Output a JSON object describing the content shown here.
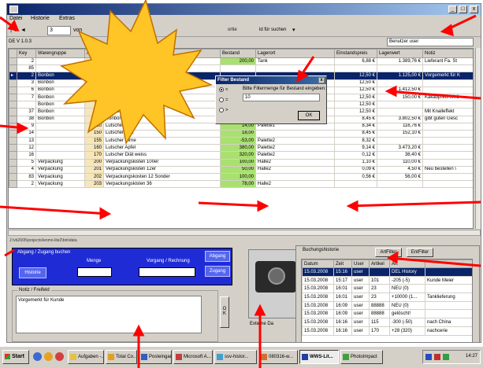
{
  "window": {
    "title": "",
    "menu": [
      "Datei",
      "Historie",
      "Extras"
    ],
    "version": "DE V 1.0.3",
    "controls": {
      "minimize": "_",
      "maximize": "□",
      "close": "x"
    }
  },
  "navigation": {
    "first": "|◄",
    "prev": "◄",
    "current": "3",
    "of_label": "von",
    "next": "►",
    "last": "►|",
    "sort_text": "ortie",
    "search_text": "ld für suchen",
    "dropdown": "▾"
  },
  "user_field": "Benutzer user",
  "grid": {
    "columns": [
      "",
      "Key",
      "Warengruppe",
      "ArtNr",
      "",
      "Bestand",
      "Lagerort",
      "Einstandspreis",
      "Lagerwert",
      "Notiz"
    ],
    "rows": [
      {
        "key": "2",
        "group": "",
        "artnr": "2",
        "name": "Sirup 5kg Sack",
        "stock": "200,00",
        "location": "Tank",
        "cost": "6,88 €",
        "value": "1.389,76 €",
        "note": "Lieferant Fa. St",
        "indicator": "",
        "green": true,
        "active": false
      },
      {
        "key": "85",
        "group": "",
        "artnr": "23",
        "name": "Sirup Fliesware",
        "stock": "",
        "location": "",
        "cost": "",
        "value": "",
        "note": "",
        "indicator": "",
        "green": false,
        "active": false
      },
      {
        "key": "2",
        "group": "Bonbon",
        "artnr": "100",
        "name": "Bonbon rot",
        "stock": "",
        "location": "",
        "cost": "12,50 €",
        "value": "1.125,00 €",
        "note": "Vorgemerkt für K",
        "indicator": "▸",
        "green": false,
        "active": true
      },
      {
        "key": "3",
        "group": "Bonbon",
        "artnr": "101",
        "name": "Bonbon blau weiss",
        "stock": "",
        "location": "",
        "cost": "12,50 €",
        "value": "",
        "note": "",
        "indicator": "",
        "green": false,
        "active": false
      },
      {
        "key": "6",
        "group": "Bonbon",
        "artnr": "102",
        "name": "Bonbon Kamille",
        "stock": "",
        "location": "",
        "cost": "12,50 €",
        "value": "1.412,50 €",
        "note": "",
        "indicator": "",
        "green": false,
        "active": false
      },
      {
        "key": "7",
        "group": "Bonbon",
        "artnr": "103",
        "name": "Bonbon Kakao",
        "stock": "",
        "location": "",
        "cost": "12,50 €",
        "value": "150,00 €",
        "note": "Kakaopreis erhö",
        "indicator": "",
        "green": false,
        "active": false
      },
      {
        "key": "",
        "group": "Bonbon",
        "artnr": "110",
        "name": "Bonbon Nikolaus",
        "stock": "-10,00",
        "location": "",
        "cost": "12,50 €",
        "value": "",
        "note": "",
        "indicator": "",
        "green": false,
        "active": false
      },
      {
        "key": "37",
        "group": "Bonbon",
        "artnr": "115",
        "name": "Bonbon Silvester",
        "stock": "-50,00",
        "location": "",
        "cost": "12,50 €",
        "value": "",
        "note": "Mit Knalleffekt",
        "indicator": "",
        "green": false,
        "active": false
      },
      {
        "key": "38",
        "group": "Bonbon",
        "artnr": "116",
        "name": "Bonbon Neujahr",
        "stock": "450,00",
        "location": "in Produktion",
        "cost": "8,45 €",
        "value": "3.802,50 €",
        "note": "gibt guten Gesc",
        "indicator": "",
        "green": true,
        "active": false
      },
      {
        "key": "9",
        "group": "",
        "artnr": "120",
        "name": "Lutscher Rot",
        "stock": "14,00",
        "location": "Palette1",
        "cost": "8,34 €",
        "value": "116,76 €",
        "note": "",
        "indicator": "",
        "green": true,
        "active": false
      },
      {
        "key": "14",
        "group": "",
        "artnr": "150",
        "name": "Lutscher Diät",
        "stock": "18,00",
        "location": "",
        "cost": "8,45 €",
        "value": "152,10 €",
        "note": "",
        "indicator": "",
        "green": true,
        "active": false
      },
      {
        "key": "13",
        "group": "",
        "artnr": "155",
        "name": "Lutscher Birne",
        "stock": "-53,00",
        "location": "Palette2",
        "cost": "8,32 €",
        "value": "",
        "note": "",
        "indicator": "",
        "green": true,
        "active": false
      },
      {
        "key": "12",
        "group": "",
        "artnr": "160",
        "name": "Lutscher Apfel",
        "stock": "380,00",
        "location": "Palette2",
        "cost": "9,14 €",
        "value": "3.473,20 €",
        "note": "",
        "indicator": "",
        "green": true,
        "active": false
      },
      {
        "key": "16",
        "group": "",
        "artnr": "170",
        "name": "Lutscher Diät weiss",
        "stock": "320,00",
        "location": "Palette2",
        "cost": "0,12 €",
        "value": "38,40 €",
        "note": "",
        "indicator": "",
        "green": true,
        "active": false
      },
      {
        "key": "5",
        "group": "Verpackung",
        "artnr": "200",
        "name": "Verpackungskisten 100er",
        "stock": "100,00",
        "location": "Halle2",
        "cost": "1,10 €",
        "value": "110,00 €",
        "note": "",
        "indicator": "",
        "green": true,
        "active": false
      },
      {
        "key": "4",
        "group": "Verpackung",
        "artnr": "201",
        "name": "Verpackungskisten 12er",
        "stock": "50,00",
        "location": "Halle2",
        "cost": "0,09 €",
        "value": "4,50 €",
        "note": "Neu bestellen \\",
        "indicator": "",
        "green": true,
        "active": false
      },
      {
        "key": "83",
        "group": "Verpackung",
        "artnr": "202",
        "name": "Verpackungskosten 12 Sonder",
        "stock": "100,00",
        "location": "",
        "cost": "0,56 €",
        "value": "56,00 €",
        "note": "",
        "indicator": "",
        "green": true,
        "active": false
      },
      {
        "key": "2",
        "group": "Verpackung",
        "artnr": "203",
        "name": "Verpackungskisten 36",
        "stock": "78,00",
        "location": "Halle2",
        "cost": "",
        "value": "",
        "note": "",
        "indicator": "",
        "green": true,
        "active": false
      }
    ]
  },
  "path_text": "J:\\vb2005\\projects\\lenmo-lite2\\bin\\data",
  "booking": {
    "title": "Abgang / Zugang buchen",
    "menge_label": "Menge",
    "vorgang_label": "Vorgang / Rechnung",
    "history_button": "Historie",
    "abgang_button": "Abgang",
    "zugang_button": "Zugang"
  },
  "notes": {
    "title": "Notiz / Freifeld",
    "text": "Vorgemerkt für Kunde",
    "ok_button": "O K"
  },
  "image_caption": "Externe Da",
  "history": {
    "title": "Buchungshistorie",
    "art_filter": "ArtFilter",
    "ent_filter": "EntFilter",
    "columns": [
      "Datum",
      "Zeit",
      "User",
      "Artikel",
      "Art"
    ],
    "rows": [
      {
        "date": "15.03.2008",
        "time": "15:16",
        "user": "user",
        "article": "",
        "art": "DEL History",
        "info": "",
        "active": true
      },
      {
        "date": "15.03.2008",
        "time": "15:17",
        "user": "user",
        "article": "101",
        "art": "-205 (-5)",
        "info": "Kunde Meier",
        "active": false
      },
      {
        "date": "15.03.2008",
        "time": "16:01",
        "user": "user",
        "article": "23",
        "art": "NEU (0)",
        "info": "",
        "active": false
      },
      {
        "date": "15.03.2008",
        "time": "16:01",
        "user": "user",
        "article": "23",
        "art": "+10000 (1...",
        "info": "Tanklieferung",
        "active": false
      },
      {
        "date": "15.03.2008",
        "time": "16:09",
        "user": "user",
        "article": "88888",
        "art": "NEU (0)",
        "info": "",
        "active": false
      },
      {
        "date": "15.03.2008",
        "time": "16:09",
        "user": "user",
        "article": "88888",
        "art": "gelöscht!",
        "info": "",
        "active": false
      },
      {
        "date": "15.03.2008",
        "time": "16:16",
        "user": "user",
        "article": "115",
        "art": "-300 (-50)",
        "info": "nach China",
        "active": false
      },
      {
        "date": "15.03.2008",
        "time": "16:16",
        "user": "user",
        "article": "170",
        "art": "+28 (320)",
        "info": "nachcerie",
        "active": false
      }
    ]
  },
  "dialog": {
    "title": "Filter Bestand",
    "prompt": "Bitte Filtermenge für Bestand eingeben:",
    "input_value": "10",
    "options": [
      "<",
      "=",
      ">"
    ],
    "ok_button": "OK",
    "close": "x"
  },
  "taskbar": {
    "start": "Start",
    "tasks": [
      "Aufgaben -...",
      "Total Co...",
      "Posteingan...",
      "Microsoft A...",
      "ssv-histor...",
      "080316-w...",
      "WWS-Lit...",
      "PhotoImpact"
    ],
    "clock": "14:27",
    "active_task_index": 6
  },
  "colors": {
    "blue_panel": "#1f2cd6",
    "green_cell": "#a9e070",
    "selected_row": "#0a246a",
    "annotation_red": "#ff0000",
    "burst_fill": "#ffc425"
  }
}
